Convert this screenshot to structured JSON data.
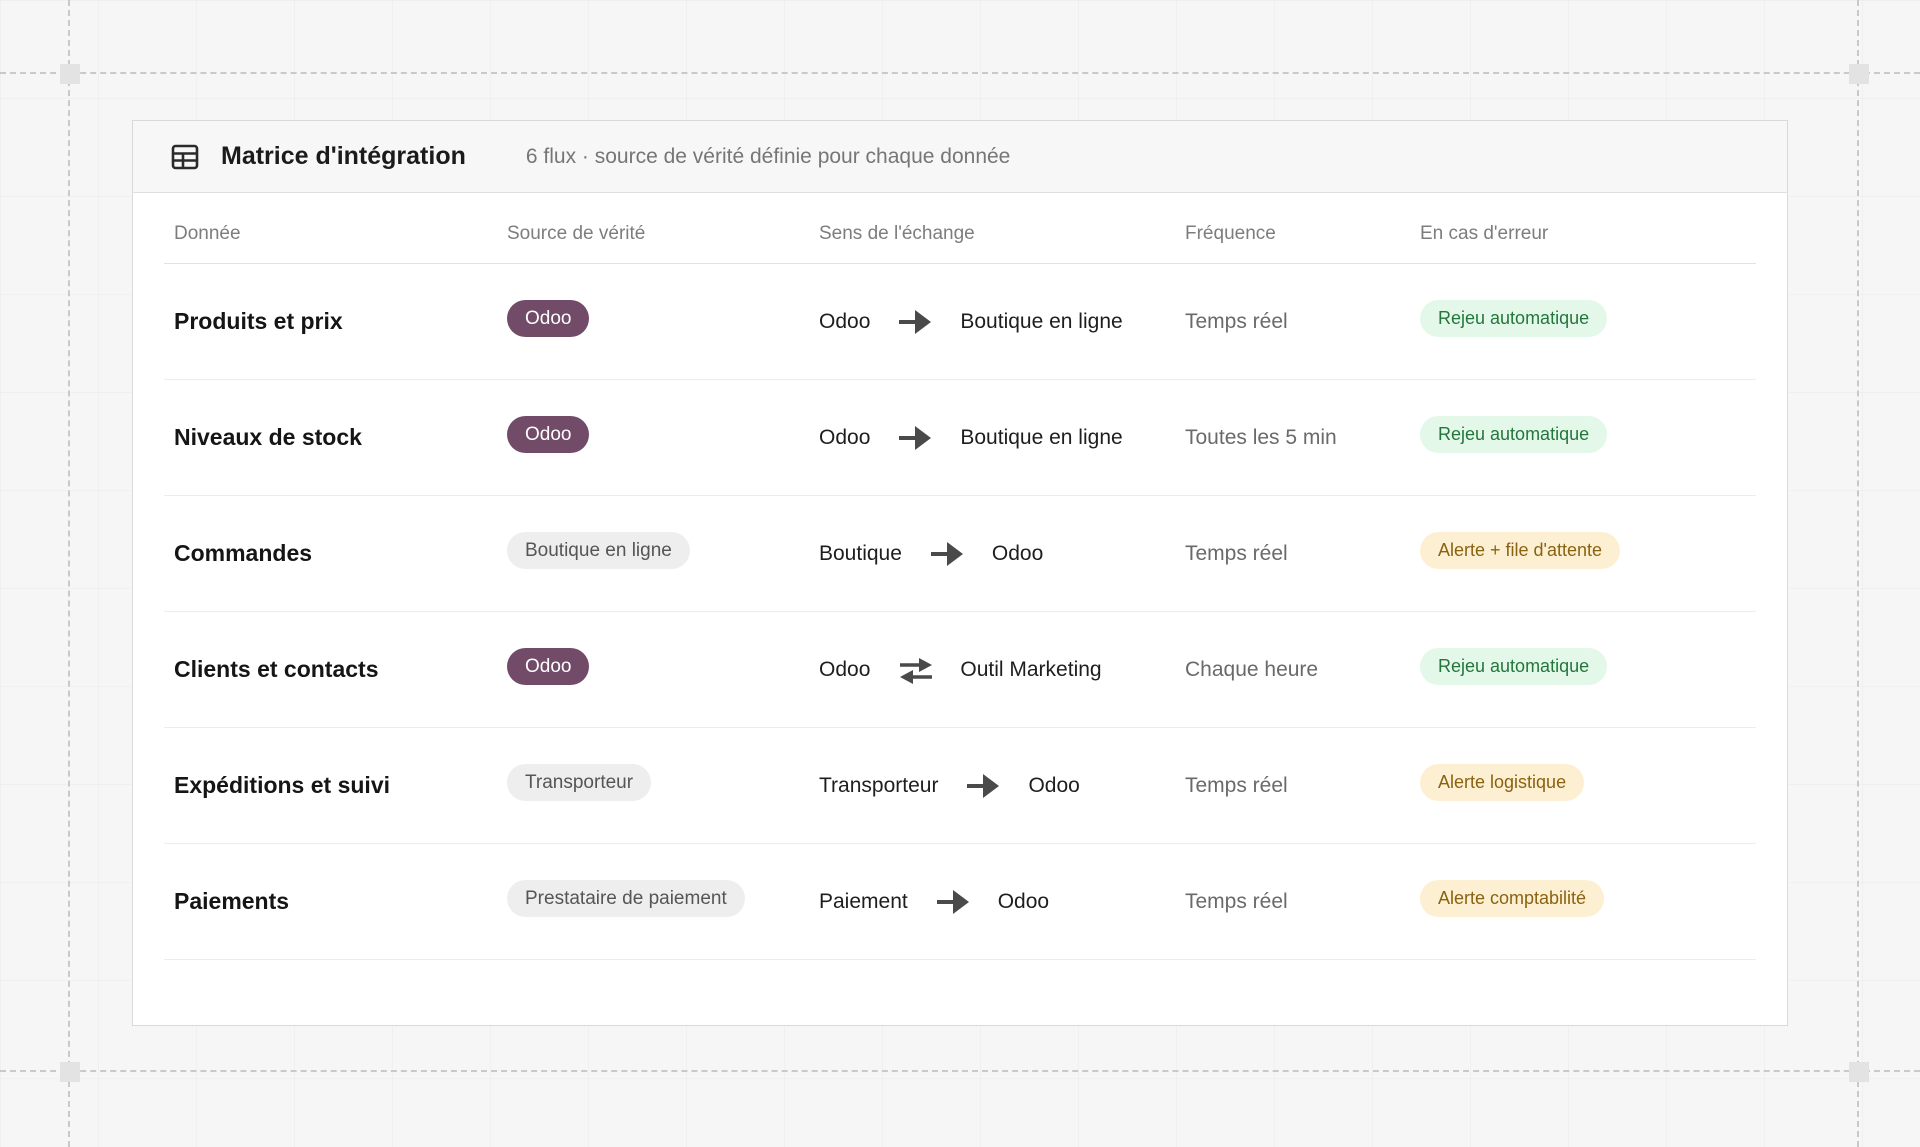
{
  "header": {
    "title": "Matrice d'intégration",
    "subtitle": "6 flux · source de vérité définie pour chaque donnée",
    "icon": "table-grid-icon"
  },
  "columns": [
    "Donnée",
    "Source de vérité",
    "Sens de l'échange",
    "Fréquence",
    "En cas d'erreur"
  ],
  "rows": [
    {
      "name": "Produits et prix",
      "source": "Odoo",
      "source_style": "primary",
      "flow_from": "Odoo",
      "flow_to": "Boutique en ligne",
      "flow_direction": "one-way",
      "frequency": "Temps réel",
      "error": "Rejeu automatique",
      "error_style": "success"
    },
    {
      "name": "Niveaux de stock",
      "source": "Odoo",
      "source_style": "primary",
      "flow_from": "Odoo",
      "flow_to": "Boutique en ligne",
      "flow_direction": "one-way",
      "frequency": "Toutes les 5 min",
      "error": "Rejeu automatique",
      "error_style": "success"
    },
    {
      "name": "Commandes",
      "source": "Boutique en ligne",
      "source_style": "neutral",
      "flow_from": "Boutique",
      "flow_to": "Odoo",
      "flow_direction": "one-way",
      "frequency": "Temps réel",
      "error": "Alerte + file d'attente",
      "error_style": "warning"
    },
    {
      "name": "Clients et contacts",
      "source": "Odoo",
      "source_style": "primary",
      "flow_from": "Odoo",
      "flow_to": "Outil Marketing",
      "flow_direction": "two-way",
      "frequency": "Chaque heure",
      "error": "Rejeu automatique",
      "error_style": "success"
    },
    {
      "name": "Expéditions et suivi",
      "source": "Transporteur",
      "source_style": "neutral",
      "flow_from": "Transporteur",
      "flow_to": "Odoo",
      "flow_direction": "one-way",
      "frequency": "Temps réel",
      "error": "Alerte logistique",
      "error_style": "warning"
    },
    {
      "name": "Paiements",
      "source": "Prestataire de paiement",
      "source_style": "neutral",
      "flow_from": "Paiement",
      "flow_to": "Odoo",
      "flow_direction": "one-way",
      "frequency": "Temps réel",
      "error": "Alerte comptabilité",
      "error_style": "warning"
    }
  ],
  "colors": {
    "odoo_badge": "#714b67",
    "neutral_badge": "#eeeeee",
    "success_badge": "#e4f8ea",
    "success_text": "#24763c",
    "warning_badge": "#fdf0d2",
    "warning_text": "#8a6212"
  }
}
